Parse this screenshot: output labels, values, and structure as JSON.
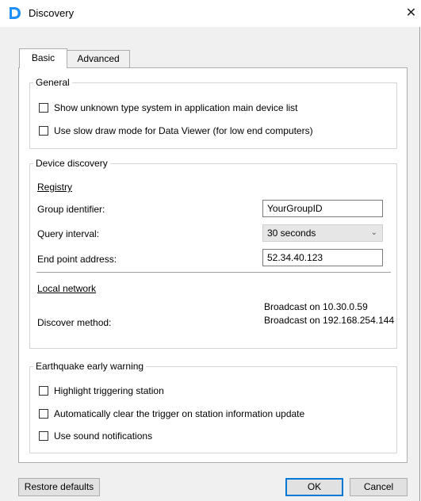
{
  "window": {
    "title": "Discovery",
    "close_glyph": "✕",
    "app_icon": "d-logo-icon",
    "accent": "#1e90ff"
  },
  "tabs": [
    {
      "label": "Basic",
      "active": true
    },
    {
      "label": "Advanced",
      "active": false
    }
  ],
  "general": {
    "legend": "General",
    "options": [
      {
        "label": "Show unknown type system in application main device list",
        "checked": false
      },
      {
        "label": "Use slow draw mode for Data Viewer (for low end computers)",
        "checked": false
      }
    ]
  },
  "device_discovery": {
    "legend": "Device discovery",
    "registry": {
      "heading": "Registry",
      "group_identifier_label": "Group identifier:",
      "group_identifier_value": "YourGroupID",
      "query_interval_label": "Query interval:",
      "query_interval_value": "30 seconds",
      "end_point_label": "End point address:",
      "end_point_value": "52.34.40.123"
    },
    "local_network": {
      "heading": "Local network",
      "discover_method_label": "Discover method:",
      "broadcast_lines": [
        "Broadcast on 10.30.0.59",
        "Broadcast on 192.168.254.144"
      ]
    }
  },
  "earthquake": {
    "legend": "Earthquake early warning",
    "options": [
      {
        "label": "Highlight triggering station",
        "checked": false
      },
      {
        "label": "Automatically clear the trigger on station information update",
        "checked": false
      },
      {
        "label": "Use sound notifications",
        "checked": false
      }
    ]
  },
  "footer": {
    "restore_label": "Restore defaults",
    "ok_label": "OK",
    "cancel_label": "Cancel"
  }
}
